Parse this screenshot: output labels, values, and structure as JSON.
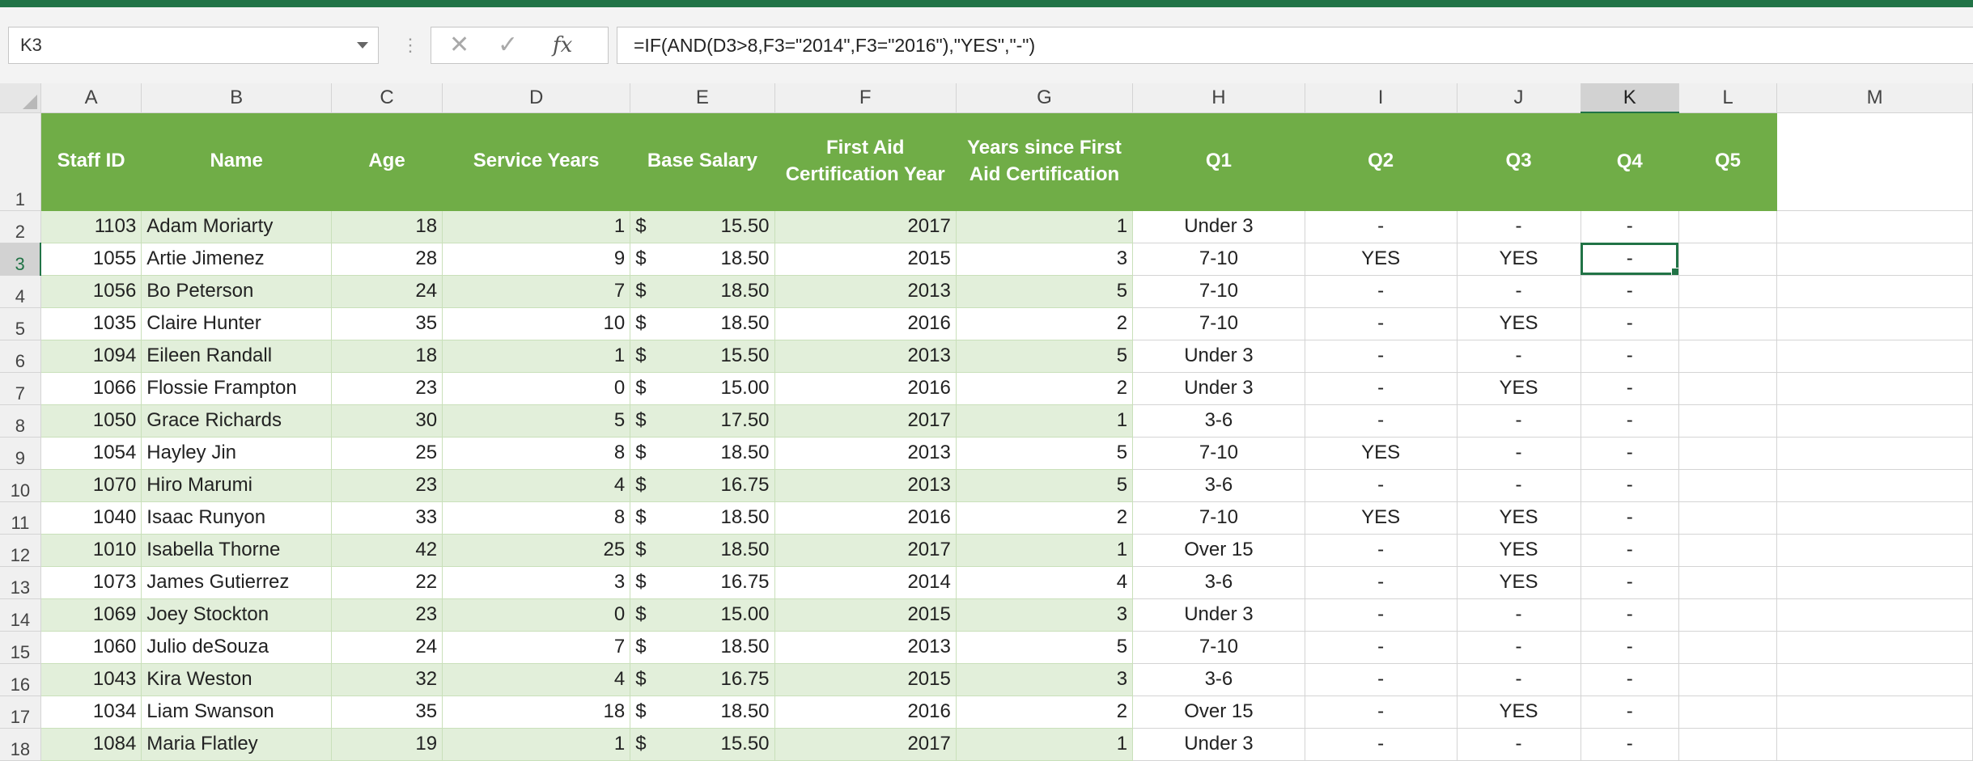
{
  "formula_bar": {
    "name_box": "K3",
    "formula": "=IF(AND(D3>8,F3=\"2014\",F3=\"2016\"),\"YES\",\"-\")",
    "cancel_icon": "✕",
    "enter_icon": "✓",
    "function_icon": "fx"
  },
  "columns": [
    "A",
    "B",
    "C",
    "D",
    "E",
    "F",
    "G",
    "H",
    "I",
    "J",
    "K",
    "L",
    "M"
  ],
  "active_cell": {
    "column": "K",
    "row": 3
  },
  "headers": {
    "staff_id": "Staff ID",
    "name": "Name",
    "age": "Age",
    "service_years": "Service Years",
    "base_salary": "Base Salary",
    "first_aid_year_1": "First Aid",
    "first_aid_year_2": "Certification Year",
    "years_since_1": "Years since First",
    "years_since_2": "Aid Certification",
    "q1": "Q1",
    "q2": "Q2",
    "q3": "Q3",
    "q4": "Q4",
    "q5": "Q5"
  },
  "rows": [
    {
      "row": "2",
      "id": "1103",
      "name": "Adam Moriarty",
      "age": "18",
      "service": "1",
      "currency": "$",
      "salary": "15.50",
      "year": "2017",
      "since": "1",
      "q1": "Under 3",
      "q2": "-",
      "q3": "-",
      "q4": "-"
    },
    {
      "row": "3",
      "id": "1055",
      "name": "Artie Jimenez",
      "age": "28",
      "service": "9",
      "currency": "$",
      "salary": "18.50",
      "year": "2015",
      "since": "3",
      "q1": "7-10",
      "q2": "YES",
      "q3": "YES",
      "q4": "-"
    },
    {
      "row": "4",
      "id": "1056",
      "name": "Bo Peterson",
      "age": "24",
      "service": "7",
      "currency": "$",
      "salary": "18.50",
      "year": "2013",
      "since": "5",
      "q1": "7-10",
      "q2": "-",
      "q3": "-",
      "q4": "-"
    },
    {
      "row": "5",
      "id": "1035",
      "name": "Claire Hunter",
      "age": "35",
      "service": "10",
      "currency": "$",
      "salary": "18.50",
      "year": "2016",
      "since": "2",
      "q1": "7-10",
      "q2": "-",
      "q3": "YES",
      "q4": "-"
    },
    {
      "row": "6",
      "id": "1094",
      "name": "Eileen Randall",
      "age": "18",
      "service": "1",
      "currency": "$",
      "salary": "15.50",
      "year": "2013",
      "since": "5",
      "q1": "Under 3",
      "q2": "-",
      "q3": "-",
      "q4": "-"
    },
    {
      "row": "7",
      "id": "1066",
      "name": "Flossie Frampton",
      "age": "23",
      "service": "0",
      "currency": "$",
      "salary": "15.00",
      "year": "2016",
      "since": "2",
      "q1": "Under 3",
      "q2": "-",
      "q3": "YES",
      "q4": "-"
    },
    {
      "row": "8",
      "id": "1050",
      "name": "Grace Richards",
      "age": "30",
      "service": "5",
      "currency": "$",
      "salary": "17.50",
      "year": "2017",
      "since": "1",
      "q1": "3-6",
      "q2": "-",
      "q3": "-",
      "q4": "-"
    },
    {
      "row": "9",
      "id": "1054",
      "name": "Hayley Jin",
      "age": "25",
      "service": "8",
      "currency": "$",
      "salary": "18.50",
      "year": "2013",
      "since": "5",
      "q1": "7-10",
      "q2": "YES",
      "q3": "-",
      "q4": "-"
    },
    {
      "row": "10",
      "id": "1070",
      "name": "Hiro Marumi",
      "age": "23",
      "service": "4",
      "currency": "$",
      "salary": "16.75",
      "year": "2013",
      "since": "5",
      "q1": "3-6",
      "q2": "-",
      "q3": "-",
      "q4": "-"
    },
    {
      "row": "11",
      "id": "1040",
      "name": "Isaac Runyon",
      "age": "33",
      "service": "8",
      "currency": "$",
      "salary": "18.50",
      "year": "2016",
      "since": "2",
      "q1": "7-10",
      "q2": "YES",
      "q3": "YES",
      "q4": "-"
    },
    {
      "row": "12",
      "id": "1010",
      "name": "Isabella Thorne",
      "age": "42",
      "service": "25",
      "currency": "$",
      "salary": "18.50",
      "year": "2017",
      "since": "1",
      "q1": "Over 15",
      "q2": "-",
      "q3": "YES",
      "q4": "-"
    },
    {
      "row": "13",
      "id": "1073",
      "name": "James Gutierrez",
      "age": "22",
      "service": "3",
      "currency": "$",
      "salary": "16.75",
      "year": "2014",
      "since": "4",
      "q1": "3-6",
      "q2": "-",
      "q3": "YES",
      "q4": "-"
    },
    {
      "row": "14",
      "id": "1069",
      "name": "Joey Stockton",
      "age": "23",
      "service": "0",
      "currency": "$",
      "salary": "15.00",
      "year": "2015",
      "since": "3",
      "q1": "Under 3",
      "q2": "-",
      "q3": "-",
      "q4": "-"
    },
    {
      "row": "15",
      "id": "1060",
      "name": "Julio deSouza",
      "age": "24",
      "service": "7",
      "currency": "$",
      "salary": "18.50",
      "year": "2013",
      "since": "5",
      "q1": "7-10",
      "q2": "-",
      "q3": "-",
      "q4": "-"
    },
    {
      "row": "16",
      "id": "1043",
      "name": "Kira Weston",
      "age": "32",
      "service": "4",
      "currency": "$",
      "salary": "16.75",
      "year": "2015",
      "since": "3",
      "q1": "3-6",
      "q2": "-",
      "q3": "-",
      "q4": "-"
    },
    {
      "row": "17",
      "id": "1034",
      "name": "Liam Swanson",
      "age": "35",
      "service": "18",
      "currency": "$",
      "salary": "18.50",
      "year": "2016",
      "since": "2",
      "q1": "Over 15",
      "q2": "-",
      "q3": "YES",
      "q4": "-"
    },
    {
      "row": "18",
      "id": "1084",
      "name": "Maria Flatley",
      "age": "19",
      "service": "1",
      "currency": "$",
      "salary": "15.50",
      "year": "2017",
      "since": "1",
      "q1": "Under 3",
      "q2": "-",
      "q3": "-",
      "q4": "-"
    }
  ],
  "colors": {
    "excel_green": "#217346",
    "table_header": "#70ad47",
    "band_row": "#e2efda"
  }
}
